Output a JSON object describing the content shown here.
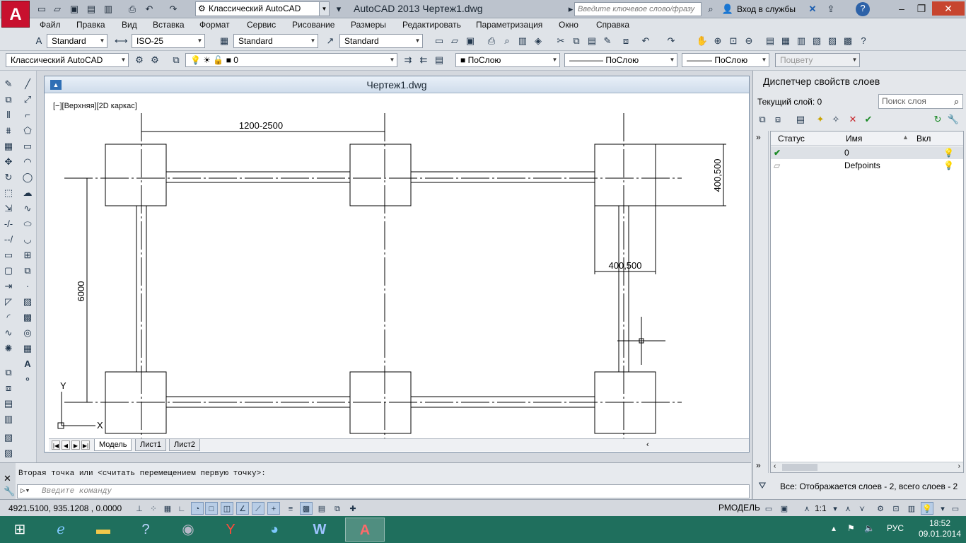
{
  "title_bar": {
    "app_title": "AutoCAD 2013    Чертеж1.dwg",
    "workspace": "Классический AutoCAD",
    "search_placeholder": "Введите ключевое слово/фразу",
    "signin": "Вход в службы",
    "help_icon": "?"
  },
  "menu": [
    "Файл",
    "Правка",
    "Вид",
    "Вставка",
    "Формат",
    "Сервис",
    "Рисование",
    "Размеры",
    "Редактировать",
    "Параметризация",
    "Окно",
    "Справка"
  ],
  "styles_toolbar": {
    "text_style": "Standard",
    "dim_style": "ISO-25",
    "table_style": "Standard",
    "mleader_style": "Standard"
  },
  "layers_toolbar": {
    "workspace": "Классический AutoCAD",
    "current_layer": "0",
    "color": "ПоСлою",
    "linetype": "ПоСлою",
    "lineweight": "ПоСлою",
    "plotstyle": "Поцвету"
  },
  "document": {
    "title": "Чертеж1.dwg",
    "viewport_label": "[−][Верхняя][2D каркас]",
    "tabs": [
      "Модель",
      "Лист1",
      "Лист2"
    ],
    "axis_y": "Y",
    "axis_x": "X"
  },
  "drawing_dims": {
    "top": "1200-2500",
    "left": "6000",
    "right_vertical": "400,500",
    "right_horizontal": "400,500"
  },
  "command_line": {
    "history": "Вторая точка или <считать перемещением первую точку>:",
    "input_placeholder": "Введите команду"
  },
  "layer_panel": {
    "title": "Диспетчер свойств слоев",
    "current_layer": "Текущий слой: 0",
    "search_placeholder": "Поиск слоя",
    "columns": [
      "Статус",
      "Имя",
      "Вкл"
    ],
    "rows": [
      {
        "status": "current",
        "name": "0"
      },
      {
        "status": "normal",
        "name": "Defpoints"
      }
    ],
    "status_text": "Все: Отображается слоев - 2, всего слоев - 2"
  },
  "status_bar": {
    "coordinates": "4921.5100, 935.1208 , 0.0000",
    "space": "РМОДЕЛЬ",
    "scale": "1:1"
  },
  "taskbar": {
    "lang": "РУС",
    "time": "18:52",
    "date": "09.01.2014"
  },
  "colors": {
    "titlebar": "#bcc3cd",
    "toolbar": "#dfe3e8",
    "taskbar": "#1f6f5d",
    "accent_red": "#c8102e"
  }
}
